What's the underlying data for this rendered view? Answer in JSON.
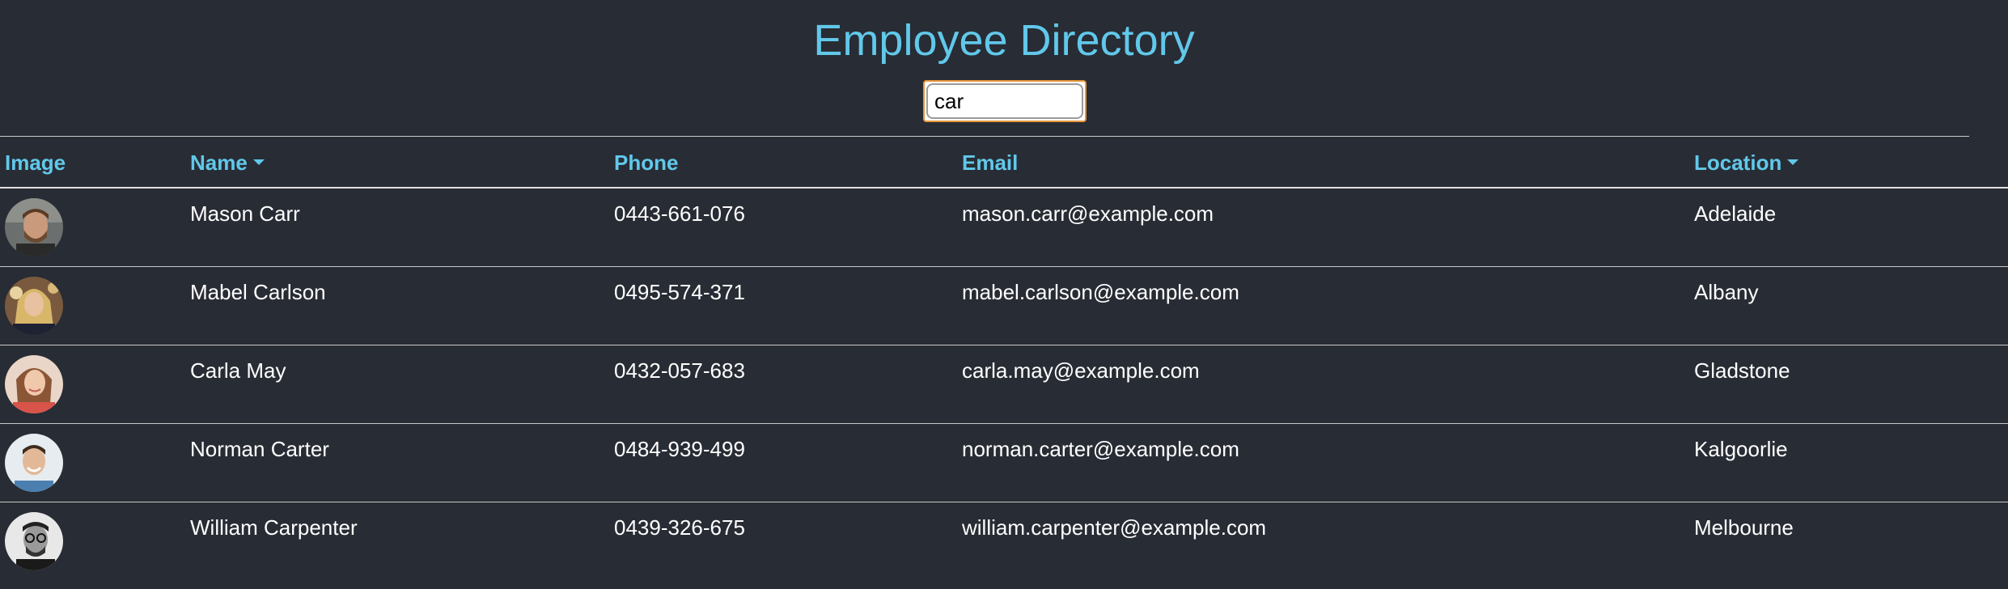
{
  "app": {
    "title": "Employee Directory"
  },
  "search": {
    "value": "car"
  },
  "table": {
    "headers": {
      "image": "Image",
      "name": "Name",
      "phone": "Phone",
      "email": "Email",
      "location": "Location"
    },
    "rows": [
      {
        "name": "Mason Carr",
        "phone": "0443-661-076",
        "email": "mason.carr@example.com",
        "location": "Adelaide",
        "avatar": "avatar-photo-man-beard"
      },
      {
        "name": "Mabel Carlson",
        "phone": "0495-574-371",
        "email": "mabel.carlson@example.com",
        "location": "Albany",
        "avatar": "avatar-photo-woman-blonde"
      },
      {
        "name": "Carla May",
        "phone": "0432-057-683",
        "email": "carla.may@example.com",
        "location": "Gladstone",
        "avatar": "avatar-photo-woman-brunette"
      },
      {
        "name": "Norman Carter",
        "phone": "0484-939-499",
        "email": "norman.carter@example.com",
        "location": "Kalgoorlie",
        "avatar": "avatar-photo-man-smiling"
      },
      {
        "name": "William Carpenter",
        "phone": "0439-326-675",
        "email": "william.carpenter@example.com",
        "location": "Melbourne",
        "avatar": "avatar-photo-man-glasses-bw"
      }
    ]
  },
  "colors": {
    "background": "#282c34",
    "accent": "#61c8ea",
    "text": "#ffffff",
    "divider": "#c8c8c8",
    "search_focus": "#e7953a"
  }
}
